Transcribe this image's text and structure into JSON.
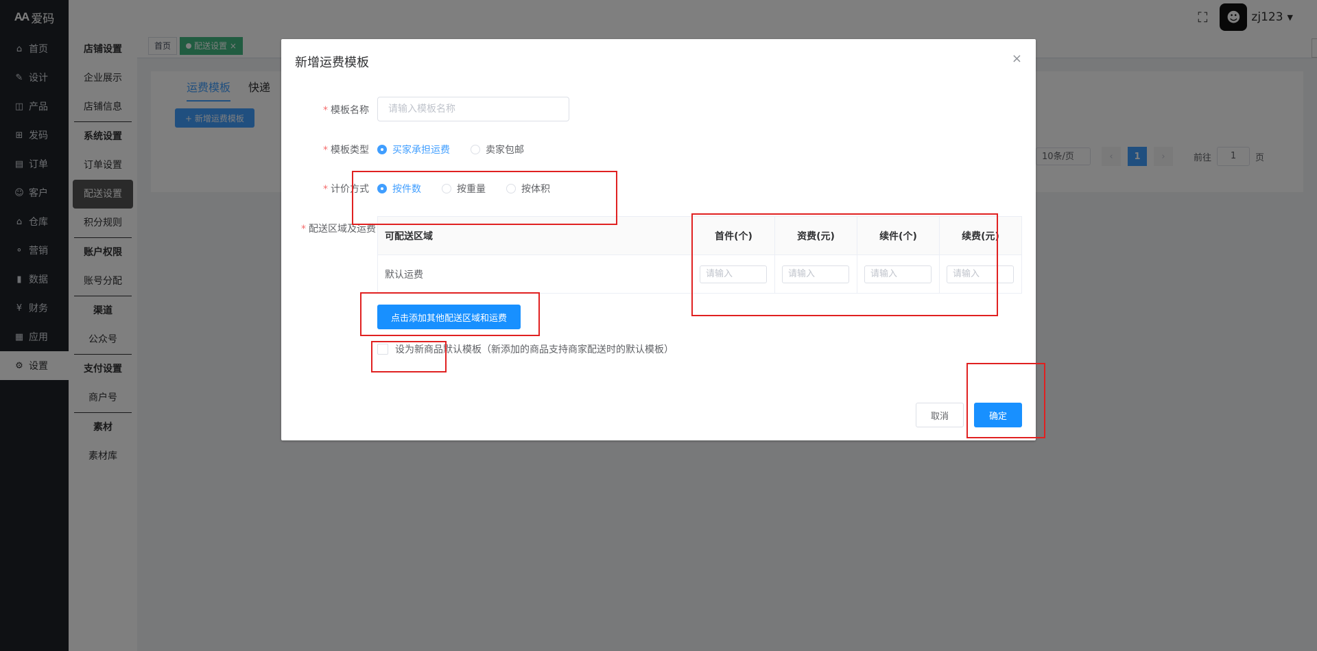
{
  "logo": {
    "mark": "AA",
    "text": "爱码"
  },
  "nav": {
    "items": [
      {
        "icon": "⌂",
        "label": "首页"
      },
      {
        "icon": "✎",
        "label": "设计"
      },
      {
        "icon": "◫",
        "label": "产品"
      },
      {
        "icon": "⊞",
        "label": "发码"
      },
      {
        "icon": "▤",
        "label": "订单"
      },
      {
        "icon": "☺",
        "label": "客户"
      },
      {
        "icon": "⌂",
        "label": "仓库"
      },
      {
        "icon": "⚬",
        "label": "营销"
      },
      {
        "icon": "▮",
        "label": "数据"
      },
      {
        "icon": "¥",
        "label": "财务"
      },
      {
        "icon": "▦",
        "label": "应用"
      },
      {
        "icon": "⚙",
        "label": "设置"
      }
    ]
  },
  "subnav": {
    "g1": "店铺设置",
    "g1_items": [
      "企业展示",
      "店铺信息"
    ],
    "g2": "系统设置",
    "g2_items": [
      "订单设置",
      "配送设置",
      "积分规则"
    ],
    "g3": "账户权限",
    "g3_items": [
      "账号分配"
    ],
    "g4": "渠道",
    "g4_items": [
      "公众号"
    ],
    "g5": "支付设置",
    "g5_items": [
      "商户号"
    ],
    "g6": "素材",
    "g6_items": [
      "素材库"
    ]
  },
  "header": {
    "username": "zj123"
  },
  "tags": {
    "home": "首页",
    "current": "配送设置",
    "close": "×"
  },
  "page": {
    "tab1": "运费模板",
    "tab2": "快递",
    "add_button": "+ 新增运费模板",
    "page_size": "10条/页",
    "prev": "‹",
    "current_page": "1",
    "next": "›",
    "goto_label": "前往",
    "goto_value": "1",
    "page_suffix": "页"
  },
  "dialog": {
    "title": "新增运费模板",
    "close": "×",
    "name_label": "模板名称",
    "name_placeholder": "请输入模板名称",
    "type_label": "模板类型",
    "type_options": [
      "买家承担运费",
      "卖家包邮"
    ],
    "method_label": "计价方式",
    "method_options": [
      "按件数",
      "按重量",
      "按体积"
    ],
    "area_label": "配送区域及运费",
    "table": {
      "headers": [
        "可配送区域",
        "首件(个)",
        "资费(元)",
        "续件(个)",
        "续费(元)"
      ],
      "row_label": "默认运费",
      "input_placeholder": "请输入"
    },
    "add_area_button": "点击添加其他配送区域和运费",
    "default_checkbox": "设为新商品默认模板（新添加的商品支持商家配送时的默认模板）",
    "cancel": "取消",
    "confirm": "确定"
  }
}
